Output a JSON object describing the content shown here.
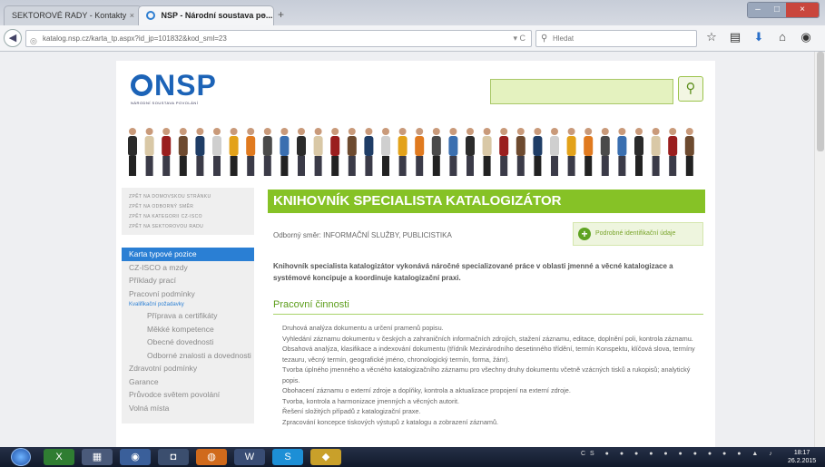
{
  "browser": {
    "tabs": [
      {
        "title": "SEKTOROVÉ RADY - Kontakty",
        "active": false
      },
      {
        "title": "NSP - Národní soustava po...",
        "active": true
      }
    ],
    "new_tab_icon": "plus-icon",
    "url": "katalog.nsp.cz/karta_tp.aspx?id_jp=101832&kod_sml=23",
    "search_placeholder": "Hledat",
    "toolbar_icons": [
      "star-icon",
      "bookmarks-icon",
      "download-icon",
      "home-icon",
      "pocket-icon",
      "menu-icon"
    ]
  },
  "site": {
    "logo_text": "NSP",
    "logo_subtitle": "NÁRODNÍ SOUSTAVA POVOLÁNÍ",
    "search_button_icon": "search-icon",
    "accent_color": "#86c226",
    "link_color": "#2a7fd4"
  },
  "sidebar": {
    "top_links": [
      "ZPĚT NA DOMOVSKOU STRÁNKU",
      "ZPĚT NA ODBORNÝ SMĚR",
      "ZPĚT NA KATEGORII CZ-ISCO",
      "ZPĚT NA SEKTOROVOU RADU"
    ],
    "menu": [
      {
        "label": "Karta typové pozice",
        "type": "active"
      },
      {
        "label": "CZ-ISCO a mzdy",
        "type": "item"
      },
      {
        "label": "Příklady prací",
        "type": "item"
      },
      {
        "label": "Pracovní podmínky",
        "type": "item"
      },
      {
        "label": "Kvalifikační požadavky",
        "type": "sub"
      },
      {
        "label": "Přípravа a certifikáty",
        "type": "ind"
      },
      {
        "label": "Měkké kompetence",
        "type": "ind"
      },
      {
        "label": "Obecné dovednosti",
        "type": "ind"
      },
      {
        "label": "Odborné znalosti a dovednosti",
        "type": "ind"
      },
      {
        "label": "Zdravotní podmínky",
        "type": "item"
      },
      {
        "label": "Garance",
        "type": "item"
      },
      {
        "label": "Průvodce světem povolání",
        "type": "item"
      },
      {
        "label": "Volná místa",
        "type": "item"
      }
    ]
  },
  "content": {
    "title": "KNIHOVNÍK SPECIALISTA KATALOGIZÁTOR",
    "obor_label": "Odborný směr:",
    "obor_value": "INFORMAČNÍ SLUŽBY, PUBLICISTIKA",
    "detail_button": "Podrobné identifikační údaje",
    "intro": "Knihovník specialista katalogizátor vykonává náročné specializované práce v oblasti jmenné a věcné katalogizace a systémové koncipuje a koordinuje katalogizační praxi.",
    "section_title": "Pracovní činnosti",
    "activities": [
      "Druhová analýza dokumentu a určení pramenů popisu.",
      "Vyhledání záznamu dokumentu v českých a zahraničních informačních zdrojích, stažení záznamu, editace, doplnění poli, kontrola záznamu.",
      "Obsahová analýza, klasifikace a indexování dokumentu (třídník Mezinárodního desetinného třídění, termín Konspektu, klíčová slova, termíny tezauru, věcný termín, geografické jméno, chronologický termín, forma, žánr).",
      "Tvorba úplného jmenného a věcného katalogizačního záznamu pro všechny druhy dokumentu včetně vzácných tisků a rukopisů; analytický popis.",
      "Obohacení záznamu o externí zdroje a doplňky, kontrola a aktualizace propojení na externí zdroje.",
      "Tvorba, kontrola a harmonizace jmenných a věcných autorit.",
      "Řešení složitých případů z katalogizační praxe.",
      "Zpracování koncepce tiskových výstupů z katalogu a zobrazení záznamů."
    ]
  },
  "taskbar": {
    "language": "CS",
    "time": "18:17",
    "date": "26.2.2015"
  }
}
